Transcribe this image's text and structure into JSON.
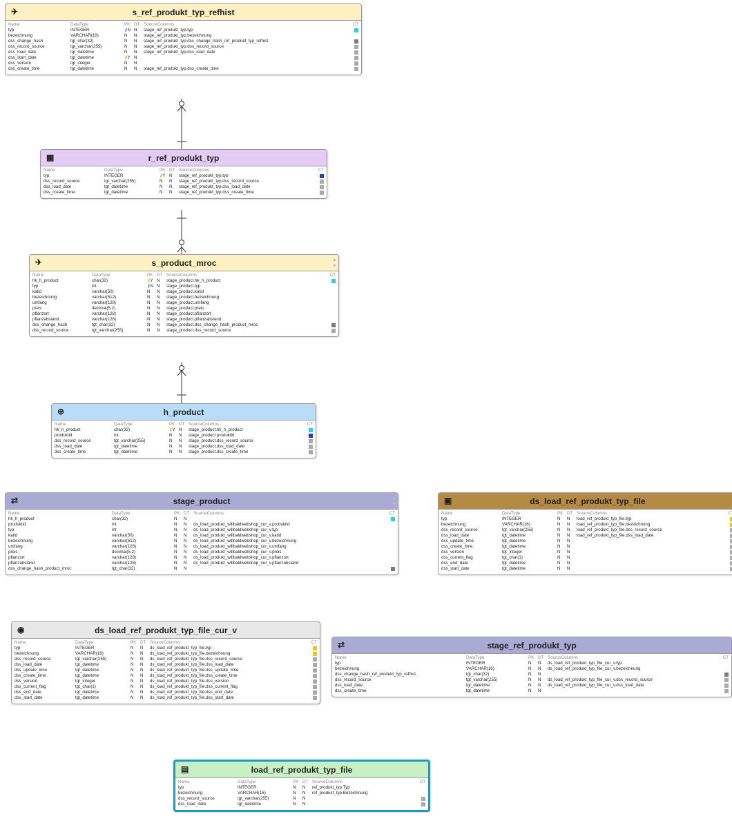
{
  "columns_header": {
    "name": "Name",
    "datatype": "DataType",
    "pk": "PK",
    "dt": "DT",
    "source": "SourceColumns",
    "ct": "CT"
  },
  "colors": {
    "cyan": "#22d3ee",
    "blue": "#1e3adb",
    "gray": "#a9a9a9",
    "darkgray": "#7a7a7a",
    "yellow": "#f2c21a"
  },
  "tables": [
    {
      "id": "s_ref_produkt_typ_refhist",
      "title": "s_ref_produkt_typ_refhist",
      "icon": "satellite-icon",
      "icon_glyph": "✈",
      "header_color": "#fdf1c4",
      "rows": [
        {
          "name": "typ",
          "type": "INTEGER",
          "key": "blue",
          "pk": "N",
          "dt": "N",
          "src": "stage_ref_produkt_typ.typ",
          "ct": "cyan"
        },
        {
          "name": "bezeichnung",
          "type": "VARCHAR(16)",
          "key": "",
          "pk": "N",
          "dt": "N",
          "src": "stage_ref_produkt_typ.bezeichnung",
          "ct": ""
        },
        {
          "name": "dss_change_hash",
          "type": "tgt_char(32)",
          "key": "",
          "pk": "N",
          "dt": "N",
          "src": "stage_ref_produkt_typ.dss_change_hash_ref_produkt_typ_refhist",
          "ct": "darkgray"
        },
        {
          "name": "dss_record_source",
          "type": "tgt_varchar(255)",
          "key": "",
          "pk": "N",
          "dt": "N",
          "src": "stage_ref_produkt_typ.dss_record_source",
          "ct": "gray"
        },
        {
          "name": "dss_load_date",
          "type": "tgt_datetime",
          "key": "",
          "pk": "N",
          "dt": "N",
          "src": "stage_ref_produkt_typ.dss_load_date",
          "ct": "gray"
        },
        {
          "name": "dss_start_date",
          "type": "tgt_datetime",
          "key": "yellow",
          "pk": "Y",
          "dt": "N",
          "src": "",
          "ct": "gray"
        },
        {
          "name": "dss_version",
          "type": "tgt_integer",
          "key": "",
          "pk": "N",
          "dt": "N",
          "src": "",
          "ct": "gray"
        },
        {
          "name": "dss_create_time",
          "type": "tgt_datetime",
          "key": "",
          "pk": "N",
          "dt": "N",
          "src": "stage_ref_produkt_typ.dss_create_time",
          "ct": "gray"
        }
      ]
    },
    {
      "id": "r_ref_produkt_typ",
      "title": "r_ref_produkt_typ",
      "icon": "reference-table-icon",
      "icon_glyph": "▦",
      "header_color": "#e4ccf7",
      "rows": [
        {
          "name": "typ",
          "type": "INTEGER",
          "key": "yellow",
          "pk": "Y",
          "dt": "N",
          "src": "stage_ref_produkt_typ.typ",
          "ct": "blue"
        },
        {
          "name": "dss_record_source",
          "type": "tgt_varchar(255)",
          "key": "",
          "pk": "N",
          "dt": "N",
          "src": "stage_ref_produkt_typ.dss_record_source",
          "ct": "gray"
        },
        {
          "name": "dss_load_date",
          "type": "tgt_datetime",
          "key": "",
          "pk": "N",
          "dt": "N",
          "src": "stage_ref_produkt_typ.dss_load_date",
          "ct": "gray"
        },
        {
          "name": "dss_create_time",
          "type": "tgt_datetime",
          "key": "",
          "pk": "N",
          "dt": "N",
          "src": "stage_ref_produkt_typ.dss_create_time",
          "ct": "gray"
        }
      ]
    },
    {
      "id": "s_product_mroc",
      "title": "s_product_mroc",
      "icon": "satellite-icon",
      "icon_glyph": "✈",
      "header_color": "#fdf1c4",
      "rows": [
        {
          "name": "hk_h_product",
          "type": "char(32)",
          "key": "yellow",
          "pk": "Y",
          "dt": "N",
          "src": "stage_product.hk_h_product",
          "ct": "cyan"
        },
        {
          "name": "typ",
          "type": "int",
          "key": "blue",
          "pk": "N",
          "dt": "N",
          "src": "stage_product.typ",
          "ct": ""
        },
        {
          "name": "katid",
          "type": "varchar(50)",
          "key": "",
          "pk": "N",
          "dt": "N",
          "src": "stage_product.katid",
          "ct": ""
        },
        {
          "name": "bezeichnung",
          "type": "varchar(512)",
          "key": "",
          "pk": "N",
          "dt": "N",
          "src": "stage_product.bezeichnung",
          "ct": ""
        },
        {
          "name": "umfang",
          "type": "varchar(128)",
          "key": "",
          "pk": "N",
          "dt": "N",
          "src": "stage_product.umfang",
          "ct": ""
        },
        {
          "name": "preis",
          "type": "decimal(5,2)",
          "key": "",
          "pk": "N",
          "dt": "N",
          "src": "stage_product.preis",
          "ct": ""
        },
        {
          "name": "pflanzort",
          "type": "varchar(128)",
          "key": "",
          "pk": "N",
          "dt": "N",
          "src": "stage_product.pflanzort",
          "ct": ""
        },
        {
          "name": "pflanzabsland",
          "type": "varchar(128)",
          "key": "",
          "pk": "N",
          "dt": "N",
          "src": "stage_product.pflanzabsland",
          "ct": ""
        },
        {
          "name": "dss_change_hash",
          "type": "tgt_char(32)",
          "key": "",
          "pk": "N",
          "dt": "N",
          "src": "stage_product.dss_change_hash_product_mroc",
          "ct": "darkgray"
        },
        {
          "name": "dss_record_source",
          "type": "tgt_varchar(255)",
          "key": "",
          "pk": "N",
          "dt": "N",
          "src": "stage_product.dss_record_source",
          "ct": "gray"
        }
      ]
    },
    {
      "id": "h_product",
      "title": "h_product",
      "icon": "hub-icon",
      "icon_glyph": "⊕",
      "header_color": "#b9dcf7",
      "rows": [
        {
          "name": "hk_h_product",
          "type": "char(32)",
          "key": "yellow",
          "pk": "Y",
          "dt": "N",
          "src": "stage_product.hk_h_product",
          "ct": "cyan"
        },
        {
          "name": "produktid",
          "type": "int",
          "key": "",
          "pk": "N",
          "dt": "N",
          "src": "stage_product.produktid",
          "ct": "blue"
        },
        {
          "name": "dss_record_source",
          "type": "tgt_varchar(255)",
          "key": "",
          "pk": "N",
          "dt": "N",
          "src": "stage_product.dss_record_source",
          "ct": "gray"
        },
        {
          "name": "dss_load_date",
          "type": "tgt_datetime",
          "key": "",
          "pk": "N",
          "dt": "N",
          "src": "stage_product.dss_load_date",
          "ct": "gray"
        },
        {
          "name": "dss_create_time",
          "type": "tgt_datetime",
          "key": "",
          "pk": "N",
          "dt": "N",
          "src": "stage_product.dss_create_time",
          "ct": "gray"
        }
      ]
    },
    {
      "id": "stage_product",
      "title": "stage_product",
      "icon": "stage-icon",
      "icon_glyph": "⇄",
      "header_color": "#aaaad4",
      "rows": [
        {
          "name": "hk_h_product",
          "type": "char(32)",
          "key": "",
          "pk": "N",
          "dt": "N",
          "src": "",
          "ct": "cyan"
        },
        {
          "name": "produktid",
          "type": "int",
          "key": "",
          "pk": "N",
          "dt": "N",
          "src": "ds_load_produkt_willbaldwebshop_cur_v.produktid",
          "ct": ""
        },
        {
          "name": "typ",
          "type": "int",
          "key": "",
          "pk": "N",
          "dt": "N",
          "src": "ds_load_produkt_willbaldwebshop_cur_v.typ",
          "ct": ""
        },
        {
          "name": "katid",
          "type": "varchar(50)",
          "key": "",
          "pk": "N",
          "dt": "N",
          "src": "ds_load_produkt_willbaldwebshop_cur_v.katid",
          "ct": ""
        },
        {
          "name": "bezeichnung",
          "type": "varchar(512)",
          "key": "",
          "pk": "N",
          "dt": "N",
          "src": "ds_load_produkt_willbaldwebshop_cur_v.bezeichnung",
          "ct": ""
        },
        {
          "name": "umfang",
          "type": "varchar(128)",
          "key": "",
          "pk": "N",
          "dt": "N",
          "src": "ds_load_produkt_willbaldwebshop_cur_v.umfang",
          "ct": ""
        },
        {
          "name": "preis",
          "type": "decimal(5,2)",
          "key": "",
          "pk": "N",
          "dt": "N",
          "src": "ds_load_produkt_willbaldwebshop_cur_v.preis",
          "ct": ""
        },
        {
          "name": "pflanzort",
          "type": "varchar(128)",
          "key": "",
          "pk": "N",
          "dt": "N",
          "src": "ds_load_produkt_willbaldwebshop_cur_v.pflanzort",
          "ct": ""
        },
        {
          "name": "pflanzabsland",
          "type": "varchar(128)",
          "key": "",
          "pk": "N",
          "dt": "N",
          "src": "ds_load_produkt_willbaldwebshop_cur_v.pflanzabsland",
          "ct": ""
        },
        {
          "name": "dss_change_hash_product_mroc",
          "type": "tgt_char(32)",
          "key": "",
          "pk": "N",
          "dt": "N",
          "src": "",
          "ct": "darkgray"
        }
      ]
    },
    {
      "id": "ds_load_ref_produkt_typ_file",
      "title": "ds_load_ref_produkt_typ_file",
      "icon": "datastore-icon",
      "icon_glyph": "▣",
      "header_color": "#b58a45",
      "rows": [
        {
          "name": "typ",
          "type": "INTEGER",
          "key": "",
          "pk": "N",
          "dt": "N",
          "src": "load_ref_produkt_typ_file.typ",
          "ct": "yellow"
        },
        {
          "name": "bezeichnung",
          "type": "VARCHAR(16)",
          "key": "",
          "pk": "N",
          "dt": "N",
          "src": "load_ref_produkt_typ_file.bezeichnung",
          "ct": "yellow"
        },
        {
          "name": "dss_record_source",
          "type": "tgt_varchar(255)",
          "key": "",
          "pk": "N",
          "dt": "N",
          "src": "load_ref_produkt_typ_file.dss_record_source",
          "ct": "gray"
        },
        {
          "name": "dss_load_date",
          "type": "tgt_datetime",
          "key": "",
          "pk": "N",
          "dt": "N",
          "src": "load_ref_produkt_typ_file.dss_load_date",
          "ct": "gray"
        },
        {
          "name": "dss_update_time",
          "type": "tgt_datetime",
          "key": "",
          "pk": "N",
          "dt": "N",
          "src": "",
          "ct": "gray"
        },
        {
          "name": "dss_create_time",
          "type": "tgt_datetime",
          "key": "",
          "pk": "N",
          "dt": "N",
          "src": "",
          "ct": "gray"
        },
        {
          "name": "dss_version",
          "type": "tgt_integer",
          "key": "",
          "pk": "N",
          "dt": "N",
          "src": "",
          "ct": "gray"
        },
        {
          "name": "dss_current_flag",
          "type": "tgt_char(1)",
          "key": "",
          "pk": "N",
          "dt": "N",
          "src": "",
          "ct": "gray"
        },
        {
          "name": "dss_end_date",
          "type": "tgt_datetime",
          "key": "",
          "pk": "N",
          "dt": "N",
          "src": "",
          "ct": "gray"
        },
        {
          "name": "dss_start_date",
          "type": "tgt_datetime",
          "key": "",
          "pk": "N",
          "dt": "N",
          "src": "",
          "ct": "gray"
        }
      ]
    },
    {
      "id": "ds_load_ref_produkt_typ_file_cur_v",
      "title": "ds_load_ref_produkt_typ_file_cur_v",
      "icon": "view-icon",
      "icon_glyph": "◉",
      "header_color": "#e8e8e8",
      "rows": [
        {
          "name": "typ",
          "type": "INTEGER",
          "key": "",
          "pk": "N",
          "dt": "N",
          "src": "ds_load_ref_produkt_typ_file.typ",
          "ct": "yellow"
        },
        {
          "name": "bezeichnung",
          "type": "VARCHAR(16)",
          "key": "",
          "pk": "N",
          "dt": "N",
          "src": "ds_load_ref_produkt_typ_file.bezeichnung",
          "ct": "yellow"
        },
        {
          "name": "dss_record_source",
          "type": "tgt_varchar(255)",
          "key": "",
          "pk": "N",
          "dt": "N",
          "src": "ds_load_ref_produkt_typ_file.dss_record_source",
          "ct": "gray"
        },
        {
          "name": "dss_load_date",
          "type": "tgt_datetime",
          "key": "",
          "pk": "N",
          "dt": "N",
          "src": "ds_load_ref_produkt_typ_file.dss_load_date",
          "ct": "gray"
        },
        {
          "name": "dss_update_time",
          "type": "tgt_datetime",
          "key": "",
          "pk": "N",
          "dt": "N",
          "src": "ds_load_ref_produkt_typ_file.dss_update_time",
          "ct": "gray"
        },
        {
          "name": "dss_create_time",
          "type": "tgt_datetime",
          "key": "",
          "pk": "N",
          "dt": "N",
          "src": "ds_load_ref_produkt_typ_file.dss_create_time",
          "ct": "gray"
        },
        {
          "name": "dss_version",
          "type": "tgt_integer",
          "key": "",
          "pk": "N",
          "dt": "N",
          "src": "ds_load_ref_produkt_typ_file.dss_version",
          "ct": "gray"
        },
        {
          "name": "dss_current_flag",
          "type": "tgt_char(1)",
          "key": "",
          "pk": "N",
          "dt": "N",
          "src": "ds_load_ref_produkt_typ_file.dss_current_flag",
          "ct": "gray"
        },
        {
          "name": "dss_end_date",
          "type": "tgt_datetime",
          "key": "",
          "pk": "N",
          "dt": "N",
          "src": "ds_load_ref_produkt_typ_file.dss_end_date",
          "ct": "gray"
        },
        {
          "name": "dss_start_date",
          "type": "tgt_datetime",
          "key": "",
          "pk": "N",
          "dt": "N",
          "src": "ds_load_ref_produkt_typ_file.dss_start_date",
          "ct": "gray"
        }
      ]
    },
    {
      "id": "stage_ref_produkt_typ",
      "title": "stage_ref_produkt_typ",
      "icon": "stage-icon",
      "icon_glyph": "⇄",
      "header_color": "#aaaad4",
      "rows": [
        {
          "name": "typ",
          "type": "INTEGER",
          "key": "",
          "pk": "N",
          "dt": "N",
          "src": "ds_load_ref_produkt_typ_file_cur_v.typ",
          "ct": ""
        },
        {
          "name": "bezeichnung",
          "type": "VARCHAR(16)",
          "key": "",
          "pk": "N",
          "dt": "N",
          "src": "ds_load_ref_produkt_typ_file_cur_v.bezeichnung",
          "ct": ""
        },
        {
          "name": "dss_change_hash_ref_produkt_typ_refhist",
          "type": "tgt_char(32)",
          "key": "",
          "pk": "N",
          "dt": "N",
          "src": "",
          "ct": "darkgray"
        },
        {
          "name": "dss_record_source",
          "type": "tgt_varchar(255)",
          "key": "",
          "pk": "N",
          "dt": "N",
          "src": "ds_load_ref_produkt_typ_file_cur_v.dss_record_source",
          "ct": "gray"
        },
        {
          "name": "dss_load_date",
          "type": "tgt_datetime",
          "key": "",
          "pk": "N",
          "dt": "N",
          "src": "ds_load_ref_produkt_typ_file_cur_v.dss_load_date",
          "ct": "gray"
        },
        {
          "name": "dss_create_time",
          "type": "tgt_datetime",
          "key": "",
          "pk": "N",
          "dt": "N",
          "src": "",
          "ct": "gray"
        }
      ]
    },
    {
      "id": "load_ref_produkt_typ_file",
      "title": "load_ref_produkt_typ_file",
      "icon": "load-icon",
      "icon_glyph": "▤",
      "header_color": "#c8f0c4",
      "selected": true,
      "rows": [
        {
          "name": "typ",
          "type": "INTEGER",
          "key": "",
          "pk": "N",
          "dt": "N",
          "src": "ref_produkt_typ.Typ",
          "ct": ""
        },
        {
          "name": "bezeichnung",
          "type": "VARCHAR(16)",
          "key": "",
          "pk": "N",
          "dt": "N",
          "src": "ref_produkt_typ.Bezeichnung",
          "ct": ""
        },
        {
          "name": "dss_record_source",
          "type": "tgt_varchar(255)",
          "key": "",
          "pk": "N",
          "dt": "N",
          "src": "",
          "ct": "gray"
        },
        {
          "name": "dss_load_date",
          "type": "tgt_datetime",
          "key": "",
          "pk": "N",
          "dt": "N",
          "src": "",
          "ct": "gray"
        }
      ]
    }
  ]
}
